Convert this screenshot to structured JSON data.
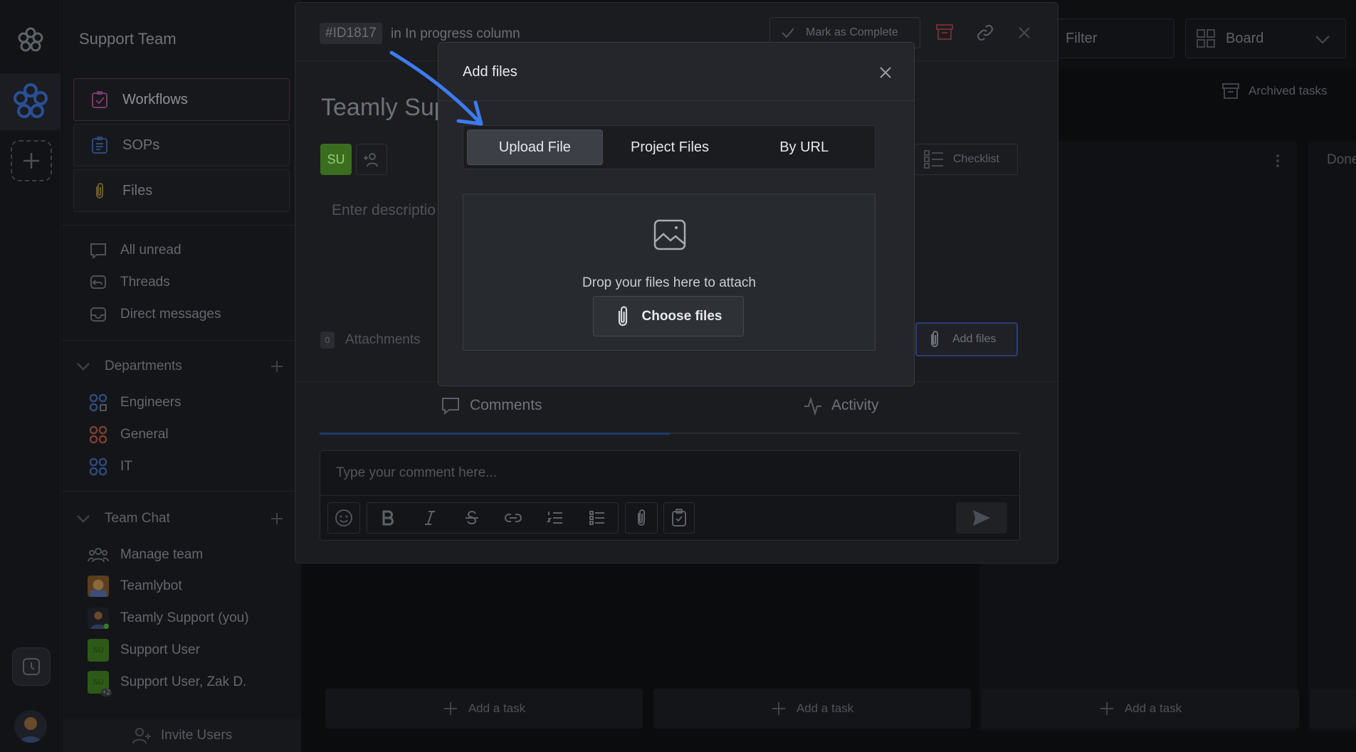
{
  "workspace": {
    "name": "Support Team"
  },
  "sidebar": {
    "primary": [
      {
        "label": "Workflows",
        "icon": "workflows-icon"
      },
      {
        "label": "SOPs",
        "icon": "sops-icon"
      },
      {
        "label": "Files",
        "icon": "paperclip-icon"
      }
    ],
    "links": [
      {
        "label": "All unread",
        "icon": "chat-bubble-icon"
      },
      {
        "label": "Threads",
        "icon": "threads-icon"
      },
      {
        "label": "Direct messages",
        "icon": "inbox-icon"
      }
    ],
    "departments": {
      "title": "Departments",
      "items": [
        {
          "label": "Engineers",
          "color": "#3a5a8c"
        },
        {
          "label": "General",
          "color": "#8a4a3a"
        },
        {
          "label": "IT",
          "color": "#3a5a8c"
        }
      ]
    },
    "team_chat": {
      "title": "Team Chat",
      "items": [
        {
          "label": "Manage team",
          "icon": "people-icon"
        },
        {
          "label": "Teamlybot",
          "icon": "bot-avatar"
        },
        {
          "label": "Teamly Support (you)",
          "icon": "user-avatar"
        },
        {
          "label": "Support User",
          "avatar_text": "SU"
        },
        {
          "label": "Support User, Zak D.",
          "avatar_text": "SU",
          "extra": "+2"
        }
      ]
    },
    "invite": "Invite Users"
  },
  "board": {
    "filter": "Filter",
    "view": "Board",
    "archived": "Archived tasks",
    "done_label": "Done",
    "add_task": "Add a task"
  },
  "task": {
    "id": "#ID1817",
    "column_text": "in In progress column",
    "mark_complete": "Mark as Complete",
    "title": "Teamly Sup",
    "assignee": "SU",
    "description_placeholder": "Enter descriptio",
    "checklist": "Checklist",
    "attachments_count": "0",
    "attachments_label": "Attachments",
    "add_files": "Add files",
    "tabs": {
      "comments": "Comments",
      "activity": "Activity"
    },
    "comment_placeholder": "Type your comment here..."
  },
  "dialog": {
    "title": "Add files",
    "tabs": [
      "Upload File",
      "Project Files",
      "By URL"
    ],
    "active_tab": "Upload File",
    "drop_text": "Drop your files here to attach",
    "choose_files": "Choose files"
  },
  "colors": {
    "accent_blue": "#3d7bf0",
    "assignee_green": "#3a6e1e",
    "dialog_bg": "#24262b"
  }
}
